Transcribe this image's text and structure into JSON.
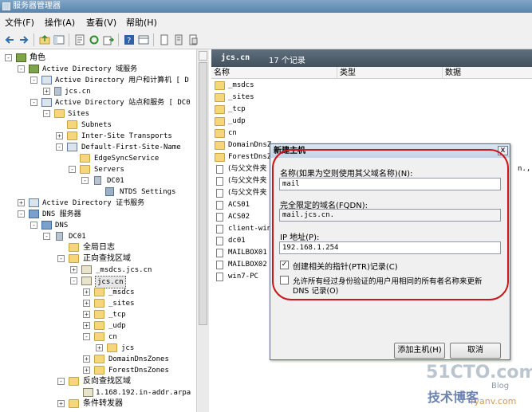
{
  "window": {
    "title": "服务器管理器"
  },
  "menu": [
    {
      "label": "文件(F)"
    },
    {
      "label": "操作(A)"
    },
    {
      "label": "查看(V)"
    },
    {
      "label": "帮助(H)"
    }
  ],
  "toolbar": {
    "icons": [
      "back-icon",
      "forward-icon",
      "up-icon",
      "show-hide-tree-icon",
      "properties-icon",
      "refresh-icon",
      "export-icon",
      "help-icon",
      "view-icon",
      "new-record-icon",
      "new-host-icon",
      "new-alias-icon"
    ]
  },
  "tree": {
    "roles": "角色",
    "ad_ds": "Active Directory 域服务",
    "ad_users": "Active Directory 用户和计算机 [ D",
    "jcs_cn_ad": "jcs.cn",
    "ad_sites": "Active Directory 站点和服务 [ DC0",
    "sites": "Sites",
    "subnets": "Subnets",
    "inter_site": "Inter-Site Transports",
    "default_site": "Default-First-Site-Name",
    "edgesync": "EdgeSyncService",
    "servers": "Servers",
    "dc01_site": "DC01",
    "ntds": "NTDS Settings",
    "ad_cs": "Active Directory 证书服务",
    "dns_server": "DNS 服务器",
    "dns": "DNS",
    "dc01": "DC01",
    "global_log": "全局日志",
    "forward_zones": "正向查找区域",
    "msdcs_zone": "_msdcs.jcs.cn",
    "jcs_zone": "jcs.cn",
    "sub_msdcs": "_msdcs",
    "sub_sites": "_sites",
    "sub_tcp": "_tcp",
    "sub_udp": "_udp",
    "sub_cn": "cn",
    "sub_jcs": "jcs",
    "domaindnszones": "DomainDnsZones",
    "forestdnszones": "ForestDnsZones",
    "reverse_zones": "反向查找区域",
    "reverse_168": "1.168.192.in-addr.arpa",
    "forwarders": "条件转发器"
  },
  "right_pane": {
    "zone_name": "jcs.cn",
    "record_count": "17 个记录",
    "columns": [
      "名称",
      "类型",
      "数据"
    ],
    "rows": [
      {
        "name": "_msdcs",
        "icon": "folder-icon"
      },
      {
        "name": "_sites",
        "icon": "folder-icon"
      },
      {
        "name": "_tcp",
        "icon": "folder-icon"
      },
      {
        "name": "_udp",
        "icon": "folder-icon"
      },
      {
        "name": "cn",
        "icon": "folder-icon"
      },
      {
        "name": "DomainDnsZ",
        "icon": "folder-icon"
      },
      {
        "name": "ForestDnsZ",
        "icon": "folder-icon"
      },
      {
        "name": "(与父文件夹",
        "icon": "record-icon"
      },
      {
        "name": "(与父文件夹",
        "icon": "record-icon"
      },
      {
        "name": "(与父文件夹",
        "icon": "record-icon"
      },
      {
        "name": "ACS01",
        "icon": "record-icon"
      },
      {
        "name": "ACS02",
        "icon": "record-icon"
      },
      {
        "name": "client-win7",
        "icon": "record-icon"
      },
      {
        "name": "dc01",
        "icon": "record-icon"
      },
      {
        "name": "MAILBOX01",
        "icon": "record-icon"
      },
      {
        "name": "MAILBOX02",
        "icon": "record-icon"
      },
      {
        "name": "win7-PC",
        "icon": "record-icon"
      }
    ],
    "data_fragment": "n.,"
  },
  "dialog": {
    "title": "新建主机",
    "close": "x",
    "name_label": "名称(如果为空则使用其父域名称)(N):",
    "name_value": "mail",
    "fqdn_label": "完全限定的域名(FQDN):",
    "fqdn_value": "mail.jcs.cn.",
    "ip_label": "IP 地址(P):",
    "ip_value": "192.168.1.254",
    "ptr_label": "创建相关的指针(PTR)记录(C)",
    "ptr_checked": true,
    "auth_label_1": "允许所有经过身份验证的用户用相同的所有者名称来更新",
    "auth_label_2": "DNS 记录(O)",
    "auth_checked": false,
    "add_button": "添加主机(H)",
    "cancel_button": "取消"
  },
  "watermark": {
    "site": "51CTO.com",
    "tag": "技术博客",
    "blog": "Blog",
    "user": "ryanv.com"
  },
  "colors": {
    "annotation_ring": "#c8181b",
    "header_bar": "#4b5966",
    "folder": "#f5d67a"
  }
}
